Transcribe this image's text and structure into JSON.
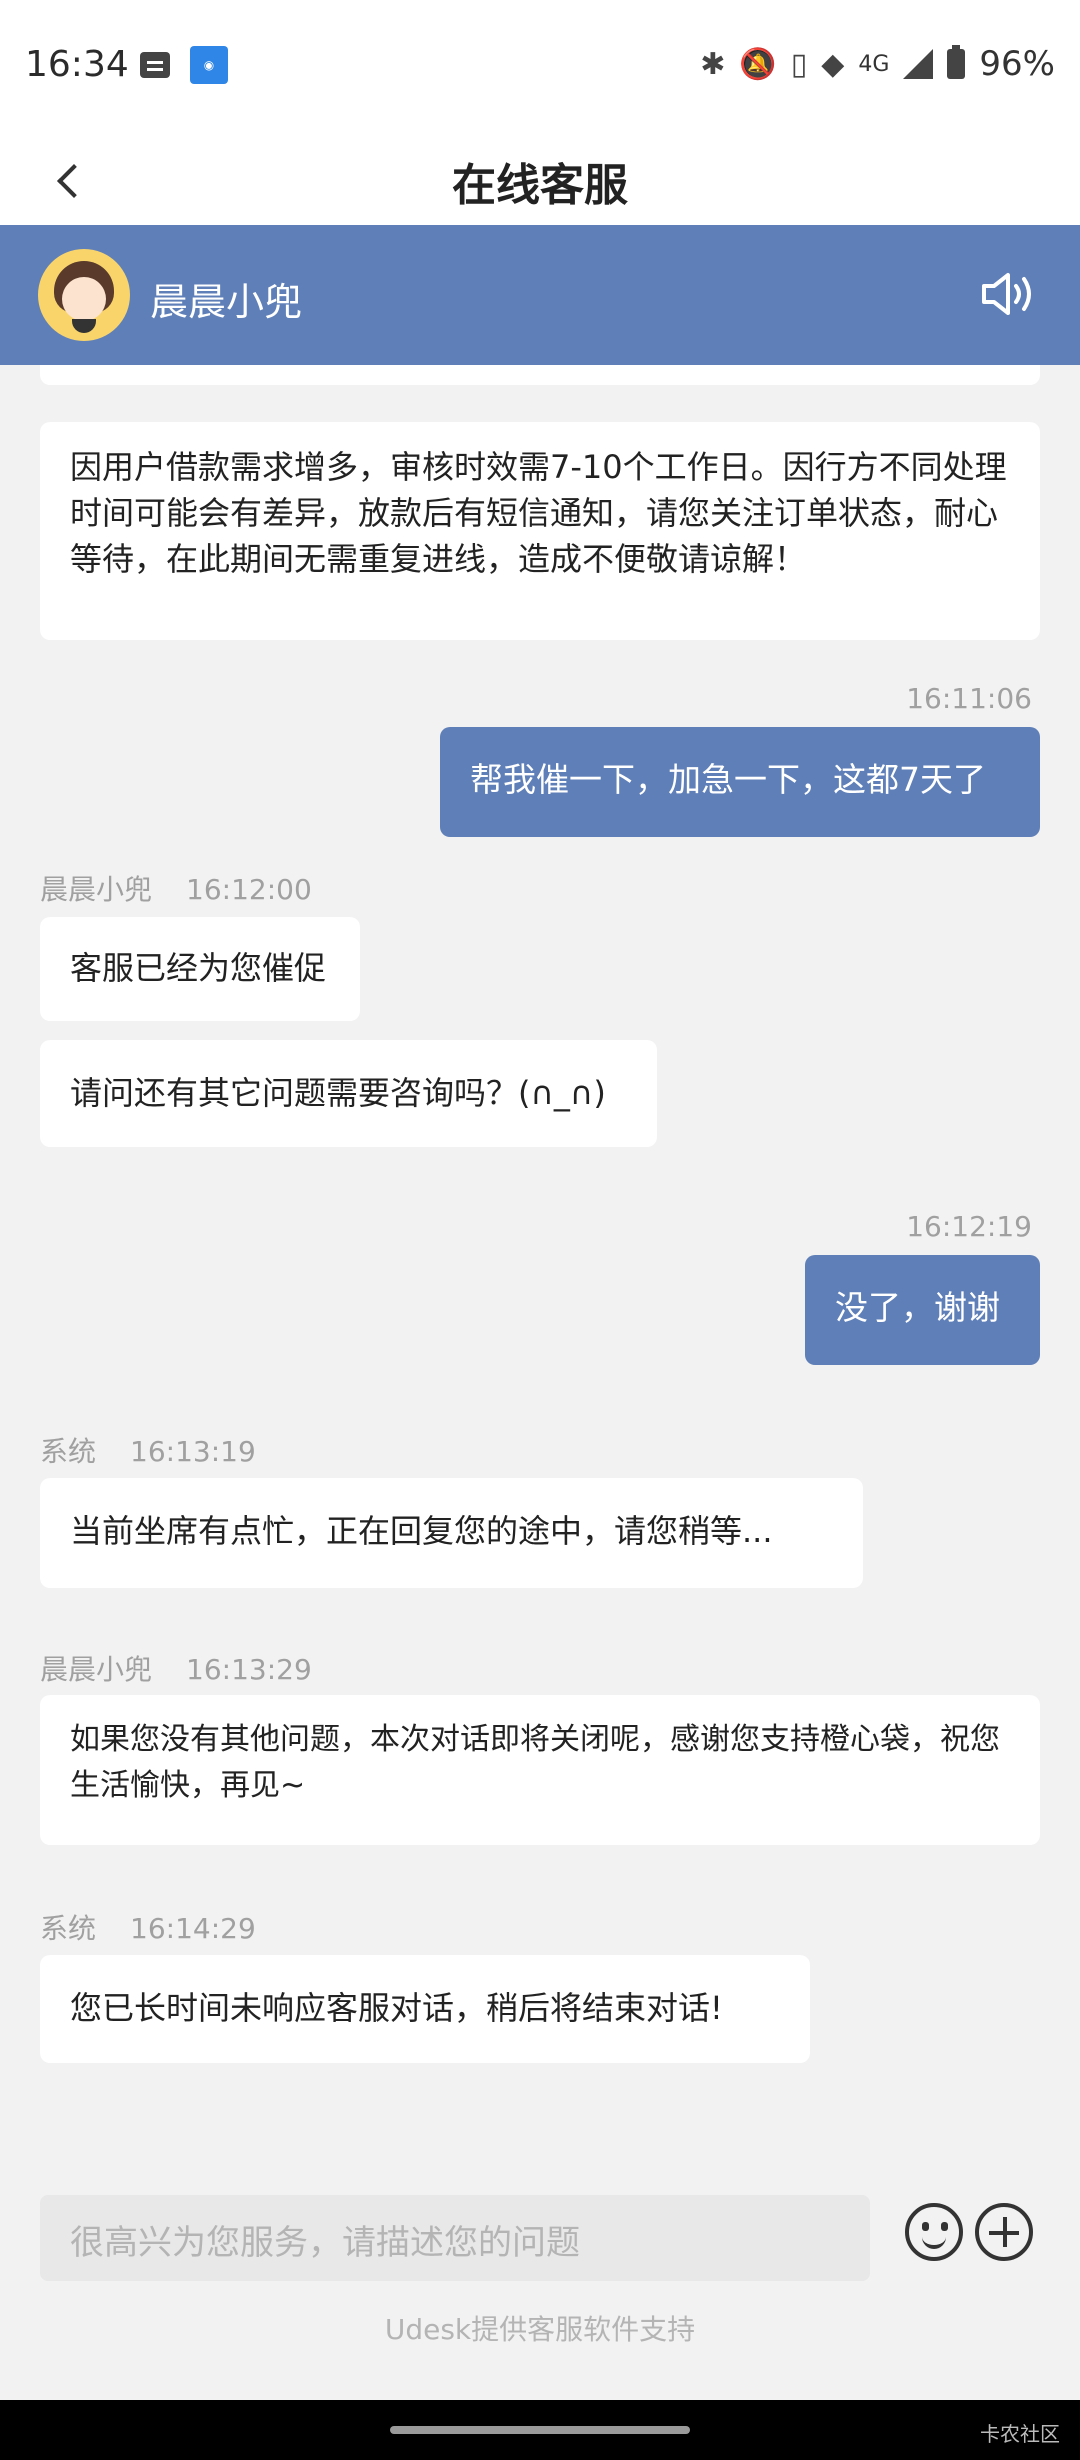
{
  "status_bar": {
    "time": "16:34",
    "network": "4G",
    "battery": "96%"
  },
  "header": {
    "title": "在线客服"
  },
  "agent": {
    "name": "晨晨小兜"
  },
  "messages": [
    {
      "type": "agent",
      "text": "因用户借款需求增多，审核时效需7-10个工作日。因行方不同处理时间可能会有差异，放款后有短信通知，请您关注订单状态，耐心等待，在此期间无需重复进线，造成不便敬请谅解！"
    },
    {
      "type": "user",
      "time": "16:11:06",
      "text": "帮我催一下，加急一下，这都7天了"
    },
    {
      "type": "agent",
      "sender": "晨晨小兜",
      "time": "16:12:00",
      "text": "客服已经为您催促"
    },
    {
      "type": "agent",
      "text": "请问还有其它问题需要咨询吗？(∩_∩)"
    },
    {
      "type": "user",
      "time": "16:12:19",
      "text": "没了，谢谢"
    },
    {
      "type": "system",
      "sender": "系统",
      "time": "16:13:19",
      "text": "当前坐席有点忙，正在回复您的途中，请您稍等..."
    },
    {
      "type": "agent",
      "sender": "晨晨小兜",
      "time": "16:13:29",
      "text": "如果您没有其他问题，本次对话即将关闭呢，感谢您支持橙心袋，祝您生活愉快，再见~"
    },
    {
      "type": "system",
      "sender": "系统",
      "time": "16:14:29",
      "text": "您已长时间未响应客服对话，稍后将结束对话!"
    }
  ],
  "input": {
    "placeholder": "很高兴为您服务，请描述您的问题"
  },
  "footer": {
    "powered_by": "Udesk提供客服软件支持"
  },
  "watermark": "卡农社区",
  "colors": {
    "accent": "#5f7fb8",
    "background": "#f2f2f2",
    "bubble": "#ffffff"
  }
}
